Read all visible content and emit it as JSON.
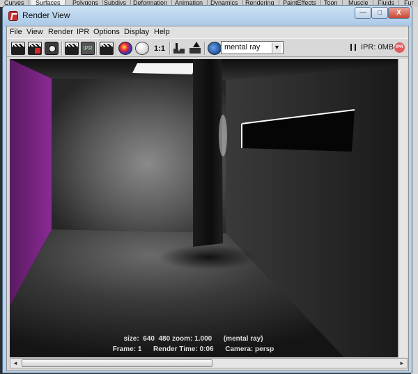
{
  "background_tabs": [
    "Curves",
    "Surfaces",
    "Polygons",
    "Subdivs",
    "Deformation",
    "Animation",
    "Dynamics",
    "Rendering",
    "PaintEffects",
    "Toon",
    "Muscle",
    "Fluids",
    "Fur"
  ],
  "window": {
    "title": "Render View"
  },
  "window_buttons": {
    "minimize": "—",
    "maximize": "□",
    "close": "X"
  },
  "menu": [
    "File",
    "View",
    "Render",
    "IPR",
    "Options",
    "Display",
    "Help"
  ],
  "toolbar": {
    "one_to_one": "1:1",
    "renderer": "mental ray",
    "ipr_memory": "IPR: 0MB",
    "ipr_badge": "IPR",
    "ipr_tool_label": "IPR"
  },
  "render_info": {
    "line1": "size:  640  480 zoom: 1.000      (mental ray)",
    "line2": "Frame: 1      Render Time: 0:06      Camera: persp"
  },
  "scrollbars": {
    "left_arrow": "◄",
    "right_arrow": "►"
  },
  "colors": {
    "title_gradient": "#a9c8e6",
    "wall_accent": "#7d2a86",
    "close_button": "#c8462f"
  }
}
